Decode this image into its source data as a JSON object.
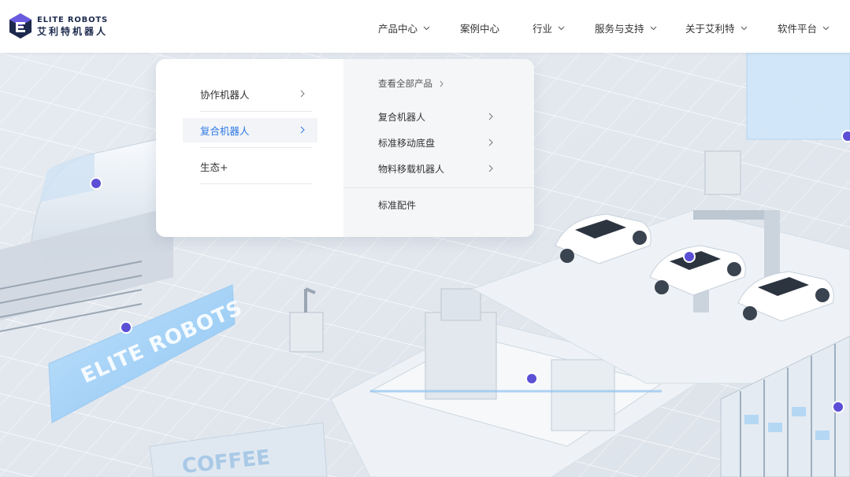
{
  "brand": {
    "name_en": "ELITE ROBOTS",
    "name_cn": "艾利特机器人",
    "colors": {
      "primary": "#1d2a4d",
      "accent": "#5b4fd6"
    }
  },
  "nav": {
    "items": [
      {
        "label": "产品中心",
        "has_dropdown": true
      },
      {
        "label": "案例中心",
        "has_dropdown": false
      },
      {
        "label": "行业",
        "has_dropdown": true
      },
      {
        "label": "服务与支持",
        "has_dropdown": true
      },
      {
        "label": "关于艾利特",
        "has_dropdown": true
      },
      {
        "label": "软件平台",
        "has_dropdown": true
      }
    ]
  },
  "dropdown": {
    "categories": [
      {
        "label": "协作机器人",
        "active": false
      },
      {
        "label": "复合机器人",
        "active": true
      },
      {
        "label": "生态+",
        "active": false
      }
    ],
    "view_all": "查看全部产品",
    "subitems": [
      {
        "label": "复合机器人"
      },
      {
        "label": "标准移动底盘"
      },
      {
        "label": "物料移载机器人"
      }
    ],
    "footer_item": "标准配件",
    "active_color": "#2e78e6"
  },
  "hero": {
    "sign_text": "ELITE ROBOTS",
    "coffee_text": "COFFEE"
  }
}
